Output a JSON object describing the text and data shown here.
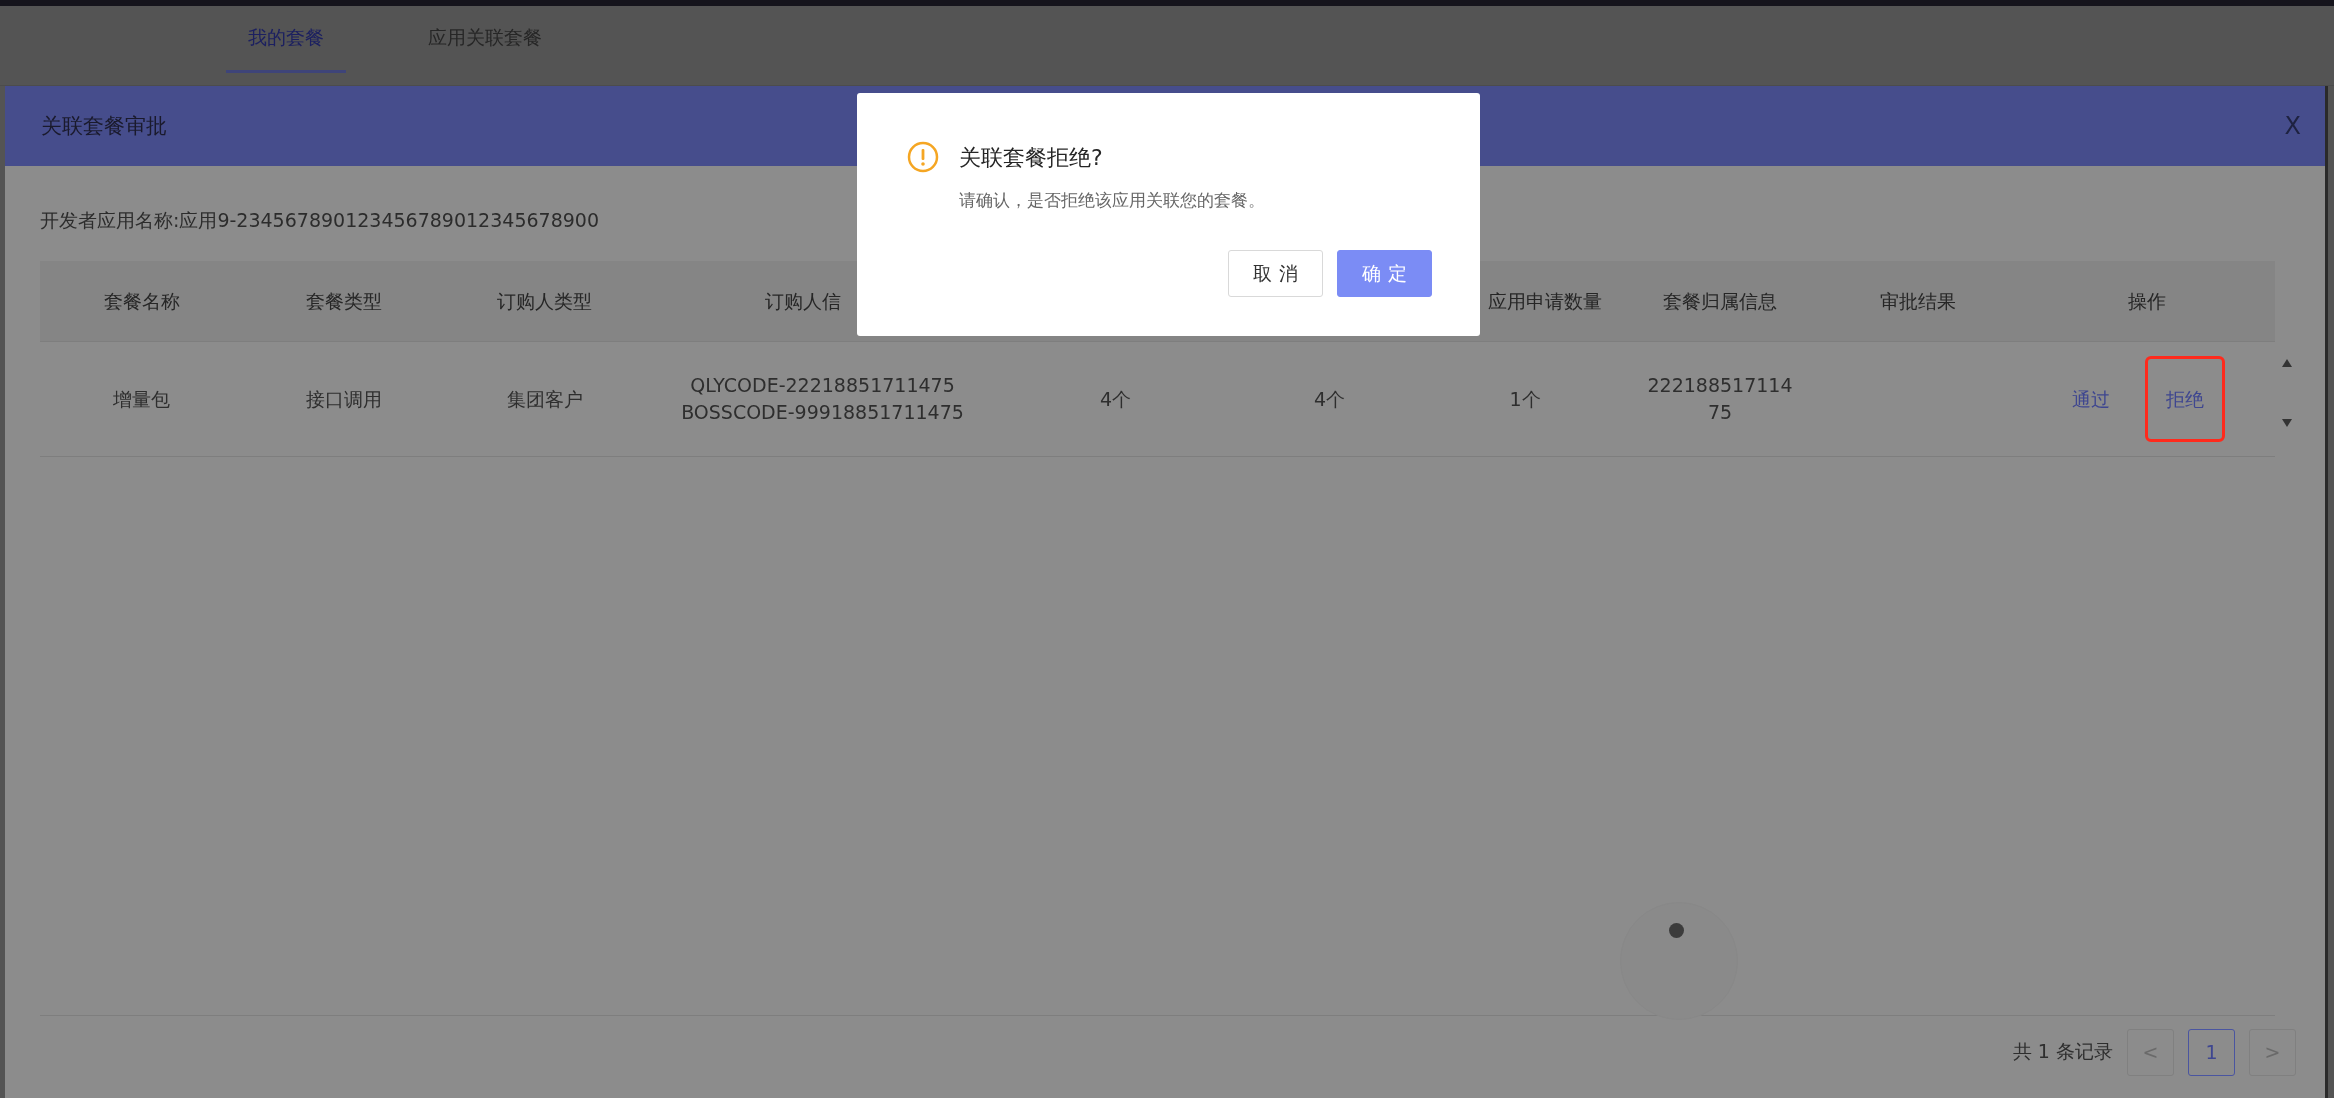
{
  "tabs": [
    {
      "label": "我的套餐",
      "selected": true
    },
    {
      "label": "应用关联套餐",
      "selected": false
    }
  ],
  "modal": {
    "title": "关联套餐审批",
    "close": "X",
    "app_name": "开发者应用名称:应用9-234567890123456789012345678900",
    "table": {
      "columns": [
        {
          "label": "套餐名称"
        },
        {
          "label": "套餐类型"
        },
        {
          "label": "订购人类型"
        },
        {
          "label": "订购人信"
        },
        {},
        {},
        {
          "label": "应用申请数量"
        },
        {
          "label": "套餐归属信息"
        },
        {
          "label": "审批结果"
        },
        {
          "label": "操作"
        }
      ],
      "rows": [
        {
          "cells": [
            "增量包",
            "接口调用",
            "集团客户",
            [
              "QLYCODE-22218851711475",
              "BOSSCODE-99918851711475"
            ],
            "4个",
            "4个",
            "1个",
            [
              "222188517114",
              "75"
            ],
            null
          ],
          "actions": [
            {
              "label": "通过",
              "highlighted": false
            },
            {
              "label": "拒绝",
              "highlighted": true
            }
          ]
        }
      ]
    },
    "loading": true,
    "pagination": {
      "total": "共 1 条记录",
      "prev": "<",
      "pages": [
        {
          "label": "1",
          "selected": true
        }
      ],
      "next": ">"
    }
  },
  "confirm": {
    "title": "关联套餐拒绝?",
    "message": "请确认，是否拒绝该应用关联您的套餐。",
    "buttons": [
      {
        "label": "取 消",
        "kind": "secondary"
      },
      {
        "label": "确 定",
        "kind": "primary"
      }
    ]
  }
}
